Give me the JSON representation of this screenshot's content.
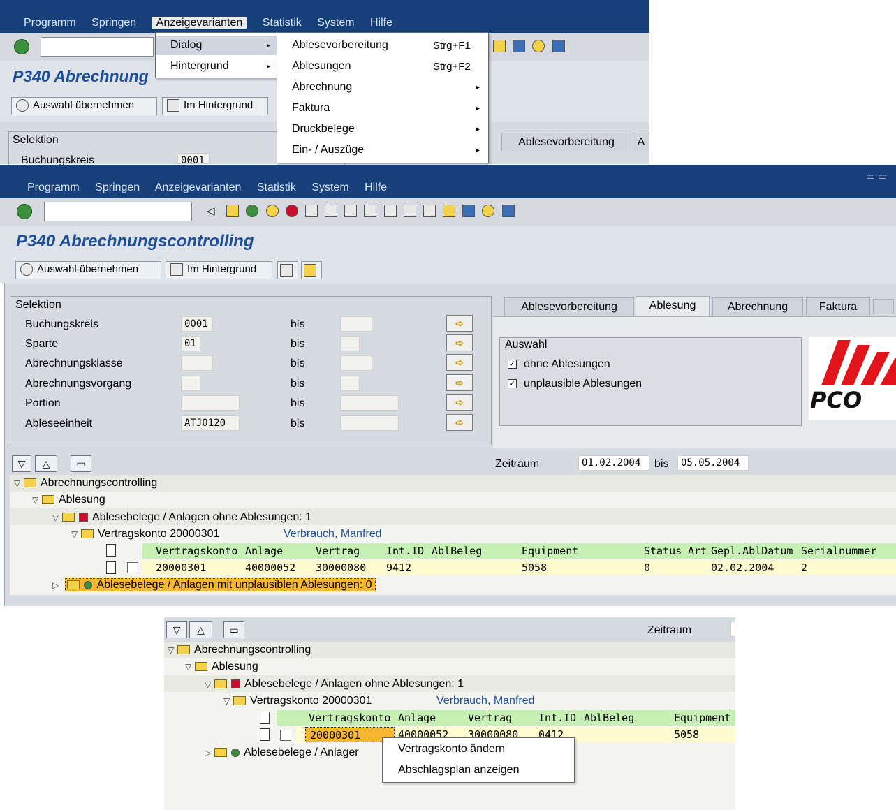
{
  "menubar": {
    "items": [
      {
        "label": "Programm"
      },
      {
        "label": "Springen"
      },
      {
        "label": "Anzeigevarianten"
      },
      {
        "label": "Statistik"
      },
      {
        "label": "System"
      },
      {
        "label": "Hilfe"
      }
    ]
  },
  "top_dropdown": {
    "col1": [
      {
        "label": "Dialog"
      },
      {
        "label": "Hintergrund"
      }
    ],
    "col2": [
      {
        "label": "Ablesevorbereitung",
        "shortcut": "Strg+F1"
      },
      {
        "label": "Ablesungen",
        "shortcut": "Strg+F2"
      },
      {
        "label": "Abrechnung"
      },
      {
        "label": "Faktura"
      },
      {
        "label": "Druckbelege"
      },
      {
        "label": "Ein- / Auszüge"
      }
    ]
  },
  "page": {
    "title": "P340 Abrechnungscontrolling",
    "title_partial": "P340 Abrechnung"
  },
  "appbar": {
    "take_selection": "Auswahl übernehmen",
    "background": "Im Hintergrund"
  },
  "selection": {
    "group_label": "Selektion",
    "bis_label": "bis",
    "rows": [
      {
        "label": "Buchungskreis",
        "value": "0001"
      },
      {
        "label": "Sparte",
        "value": "01"
      },
      {
        "label": "Abrechnungsklasse",
        "value": ""
      },
      {
        "label": "Abrechnungsvorgang",
        "value": ""
      },
      {
        "label": "Portion",
        "value": ""
      },
      {
        "label": "Ableseeinheit",
        "value": "ATJ0120"
      }
    ]
  },
  "tabs": {
    "items": [
      {
        "label": "Ablesevorbereitung"
      },
      {
        "label": "Ablesung"
      },
      {
        "label": "Abrechnung"
      },
      {
        "label": "Faktura"
      }
    ],
    "partial_label": "A"
  },
  "auswahl": {
    "label": "Auswahl",
    "options": [
      {
        "label": "ohne Ablesungen",
        "checked": true
      },
      {
        "label": "unplausible Ablesungen",
        "checked": true
      }
    ]
  },
  "logo": {
    "text": "PCO"
  },
  "zeitraum": {
    "label": "Zeitraum",
    "from": "01.02.2004",
    "bis": "bis",
    "to": "05.05.2004"
  },
  "tree": {
    "root": "Abrechnungscontrolling",
    "level1": "Ablesung",
    "node_no_reading": "Ablesebelege / Anlagen ohne Ablesungen:  1",
    "vertragskonto_label": "Vertragskonto  20000301",
    "vertragskonto_name": "Verbrauch, Manfred",
    "node_implausible": "Ablesebelege / Anlagen mit unplausiblen Ablesungen:  0",
    "node_implausible_partial": "Ablesebelege / Anlager",
    "columns": [
      "Vertragskonto",
      "Anlage",
      "Vertrag",
      "Int.ID",
      "AblBeleg",
      "Equipment",
      "Status",
      "Art",
      "Gepl.AblDatum",
      "Serialnummer"
    ],
    "row": {
      "vertragskonto": "20000301",
      "anlage": "40000052",
      "vertrag": "30000080",
      "int_id": "9412",
      "equipment": "5058",
      "status": "0",
      "gepl_datum": "02.02.2004",
      "serialnummer": "2"
    },
    "row_partial": {
      "anlage": "40000052",
      "vertrag": "30000080",
      "int_id": "0412"
    }
  },
  "context_menu": {
    "items": [
      {
        "label": "Vertragskonto ändern"
      },
      {
        "label": "Abschlagsplan anzeigen"
      }
    ]
  }
}
